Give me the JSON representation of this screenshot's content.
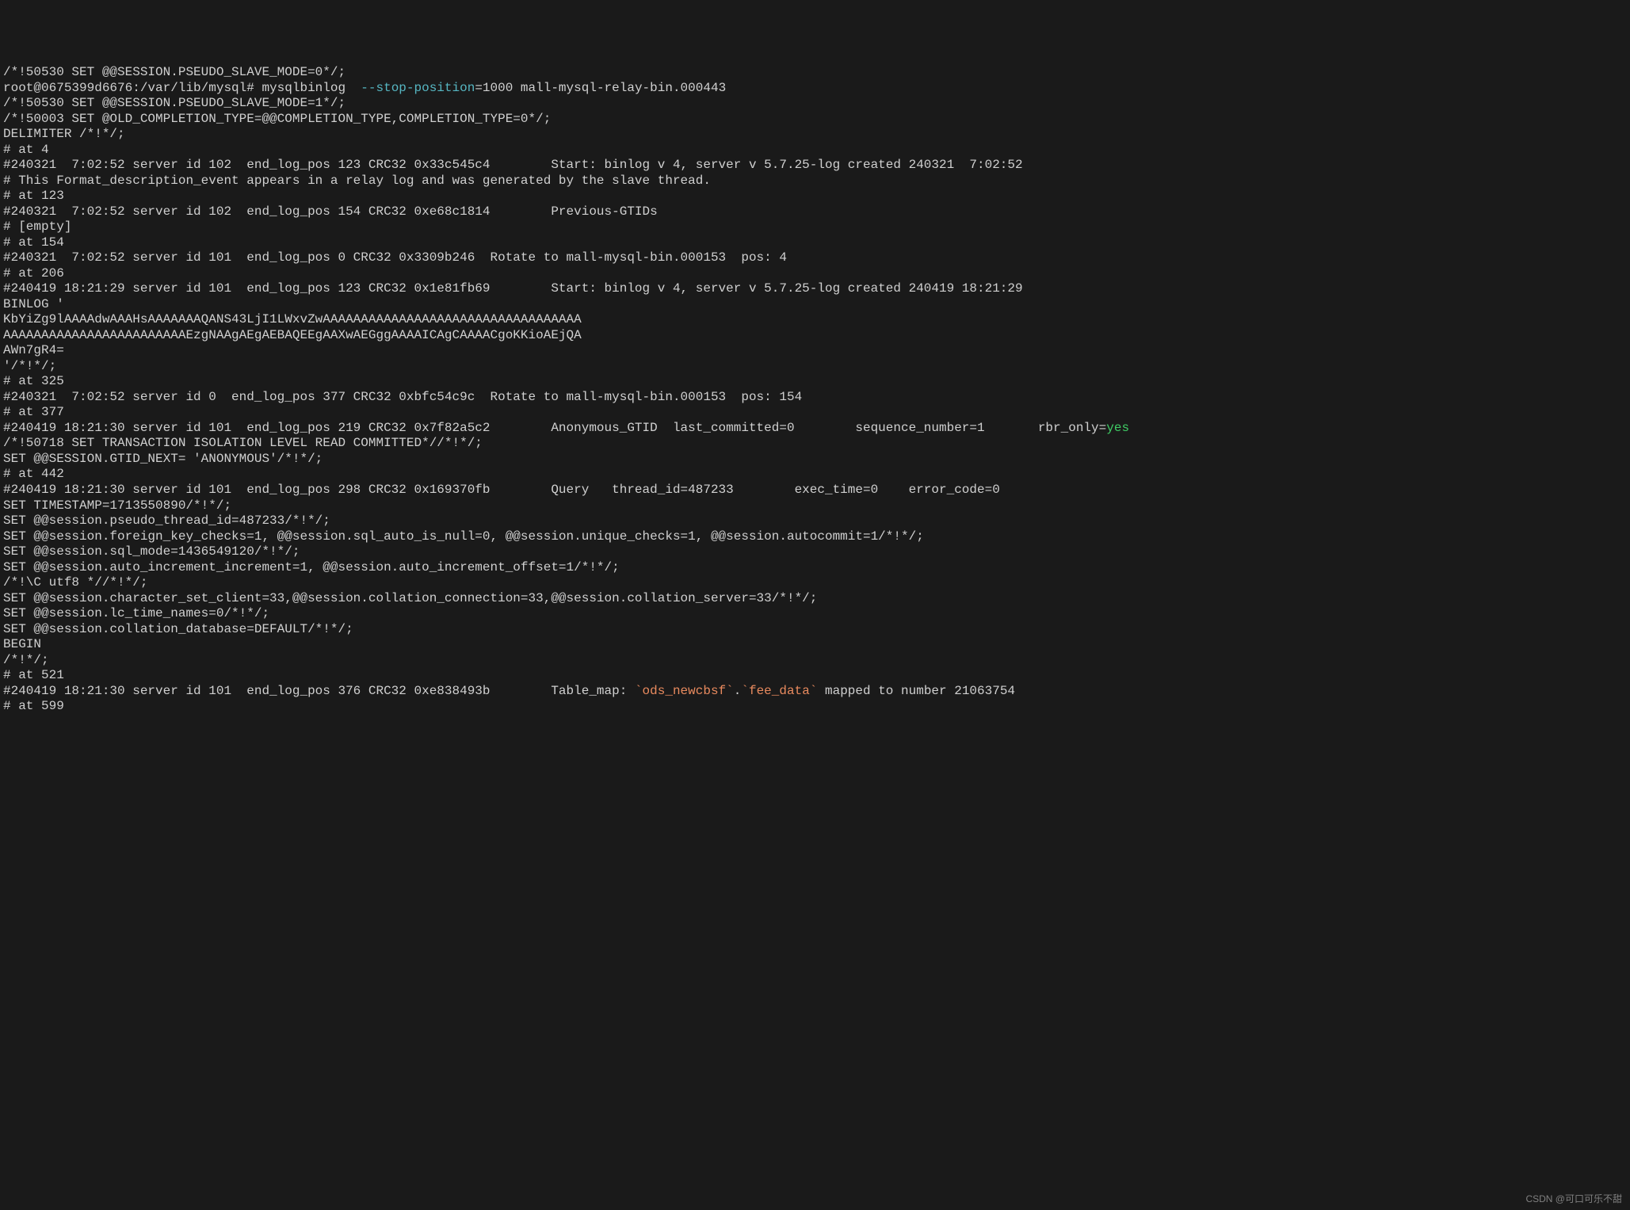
{
  "terminal": {
    "lines": [
      {
        "segments": [
          {
            "t": "/*!50530 SET @@SESSION.PSEUDO_SLAVE_MODE=0*/;"
          }
        ]
      },
      {
        "segments": [
          {
            "t": "root@0675399d6676:/var/lib/mysql# mysqlbinlog  "
          },
          {
            "t": "--stop-position",
            "cls": "c-blue"
          },
          {
            "t": "=1000 mall-mysql-relay-bin.000443"
          }
        ]
      },
      {
        "segments": [
          {
            "t": "/*!50530 SET @@SESSION.PSEUDO_SLAVE_MODE=1*/;"
          }
        ]
      },
      {
        "segments": [
          {
            "t": "/*!50003 SET @OLD_COMPLETION_TYPE=@@COMPLETION_TYPE,COMPLETION_TYPE=0*/;"
          }
        ]
      },
      {
        "segments": [
          {
            "t": "DELIMITER /*!*/;"
          }
        ]
      },
      {
        "segments": [
          {
            "t": "# at 4"
          }
        ]
      },
      {
        "segments": [
          {
            "t": "#240321  7:02:52 server id 102  end_log_pos 123 CRC32 0x33c545c4        Start: binlog v 4, server v 5.7.25-log created 240321  7:02:52"
          }
        ]
      },
      {
        "segments": [
          {
            "t": "# This Format_description_event appears in a relay log and was generated by the slave thread."
          }
        ]
      },
      {
        "segments": [
          {
            "t": "# at 123"
          }
        ]
      },
      {
        "segments": [
          {
            "t": "#240321  7:02:52 server id 102  end_log_pos 154 CRC32 0xe68c1814        Previous-GTIDs"
          }
        ]
      },
      {
        "segments": [
          {
            "t": "# [empty]"
          }
        ]
      },
      {
        "segments": [
          {
            "t": "# at 154"
          }
        ]
      },
      {
        "segments": [
          {
            "t": "#240321  7:02:52 server id 101  end_log_pos 0 CRC32 0x3309b246  Rotate to mall-mysql-bin.000153  pos: 4"
          }
        ]
      },
      {
        "segments": [
          {
            "t": "# at 206"
          }
        ]
      },
      {
        "segments": [
          {
            "t": "#240419 18:21:29 server id 101  end_log_pos 123 CRC32 0x1e81fb69        Start: binlog v 4, server v 5.7.25-log created 240419 18:21:29"
          }
        ]
      },
      {
        "segments": [
          {
            "t": "BINLOG '"
          }
        ]
      },
      {
        "segments": [
          {
            "t": "KbYiZg9lAAAAdwAAAHsAAAAAAAQANS43LjI1LWxvZwAAAAAAAAAAAAAAAAAAAAAAAAAAAAAAAAAA"
          }
        ]
      },
      {
        "segments": [
          {
            "t": "AAAAAAAAAAAAAAAAAAAAAAAAEzgNAAgAEgAEBAQEEgAAXwAEGggAAAAICAgCAAAACgoKKioAEjQA"
          }
        ]
      },
      {
        "segments": [
          {
            "t": "AWn7gR4="
          }
        ]
      },
      {
        "segments": [
          {
            "t": "'/*!*/;"
          }
        ]
      },
      {
        "segments": [
          {
            "t": "# at 325"
          }
        ]
      },
      {
        "segments": [
          {
            "t": "#240321  7:02:52 server id 0  end_log_pos 377 CRC32 0xbfc54c9c  Rotate to mall-mysql-bin.000153  pos: 154"
          }
        ]
      },
      {
        "segments": [
          {
            "t": "# at 377"
          }
        ]
      },
      {
        "segments": [
          {
            "t": "#240419 18:21:30 server id 101  end_log_pos 219 CRC32 0x7f82a5c2        Anonymous_GTID  last_committed=0        sequence_number=1       rbr_only="
          },
          {
            "t": "yes",
            "cls": "c-green"
          }
        ]
      },
      {
        "segments": [
          {
            "t": "/*!50718 SET TRANSACTION ISOLATION LEVEL READ COMMITTED*//*!*/;"
          }
        ]
      },
      {
        "segments": [
          {
            "t": "SET @@SESSION.GTID_NEXT= 'ANONYMOUS'/*!*/;"
          }
        ]
      },
      {
        "segments": [
          {
            "t": "# at 442"
          }
        ]
      },
      {
        "segments": [
          {
            "t": "#240419 18:21:30 server id 101  end_log_pos 298 CRC32 0x169370fb        Query   thread_id=487233        exec_time=0    error_code=0"
          }
        ]
      },
      {
        "segments": [
          {
            "t": "SET TIMESTAMP=1713550890/*!*/;"
          }
        ]
      },
      {
        "segments": [
          {
            "t": "SET @@session.pseudo_thread_id=487233/*!*/;"
          }
        ]
      },
      {
        "segments": [
          {
            "t": "SET @@session.foreign_key_checks=1, @@session.sql_auto_is_null=0, @@session.unique_checks=1, @@session.autocommit=1/*!*/;"
          }
        ]
      },
      {
        "segments": [
          {
            "t": "SET @@session.sql_mode=1436549120/*!*/;"
          }
        ]
      },
      {
        "segments": [
          {
            "t": "SET @@session.auto_increment_increment=1, @@session.auto_increment_offset=1/*!*/;"
          }
        ]
      },
      {
        "segments": [
          {
            "t": "/*!\\C utf8 *//*!*/;"
          }
        ]
      },
      {
        "segments": [
          {
            "t": "SET @@session.character_set_client=33,@@session.collation_connection=33,@@session.collation_server=33/*!*/;"
          }
        ]
      },
      {
        "segments": [
          {
            "t": "SET @@session.lc_time_names=0/*!*/;"
          }
        ]
      },
      {
        "segments": [
          {
            "t": "SET @@session.collation_database=DEFAULT/*!*/;"
          }
        ]
      },
      {
        "segments": [
          {
            "t": "BEGIN"
          }
        ]
      },
      {
        "segments": [
          {
            "t": "/*!*/;"
          }
        ]
      },
      {
        "segments": [
          {
            "t": "# at 521"
          }
        ]
      },
      {
        "segments": [
          {
            "t": "#240419 18:21:30 server id 101  end_log_pos 376 CRC32 0xe838493b        Table_map: "
          },
          {
            "t": "`ods_newcbsf`",
            "cls": "c-coral"
          },
          {
            "t": "."
          },
          {
            "t": "`fee_data`",
            "cls": "c-coral"
          },
          {
            "t": " mapped to number 21063754"
          }
        ]
      },
      {
        "segments": [
          {
            "t": "# at 599"
          }
        ]
      }
    ]
  },
  "watermark": "CSDN @可口可乐不甜"
}
